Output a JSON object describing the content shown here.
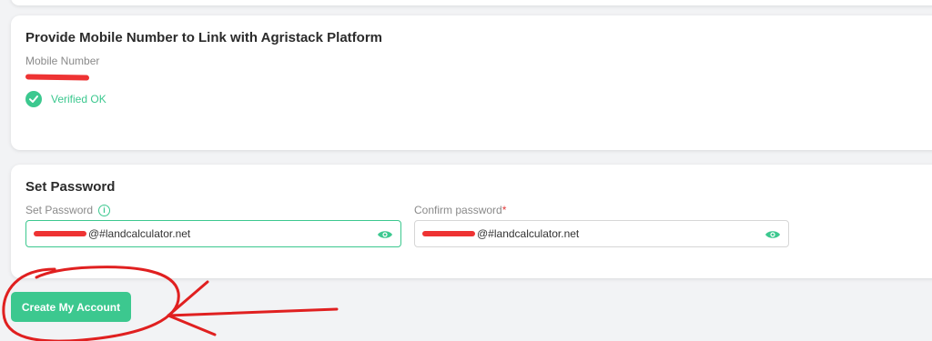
{
  "mobile_section": {
    "title": "Provide Mobile Number to Link with Agristack Platform",
    "mobile_label": "Mobile Number",
    "verified_text": "Verified OK"
  },
  "password_section": {
    "title": "Set Password",
    "set_password_label": "Set Password",
    "confirm_password_label": "Confirm password",
    "required_mark": "*",
    "set_password_value_visible": "@#landcalculator.net",
    "confirm_password_value_visible": "@#landcalculator.net"
  },
  "actions": {
    "create_account_label": "Create My Account"
  },
  "icons": {
    "verified": "check-circle-icon",
    "info": "info-icon",
    "reveal_password": "eye-icon"
  },
  "colors": {
    "accent": "#3cc88f",
    "required": "#e23b3b",
    "annotation": "#e02020"
  }
}
